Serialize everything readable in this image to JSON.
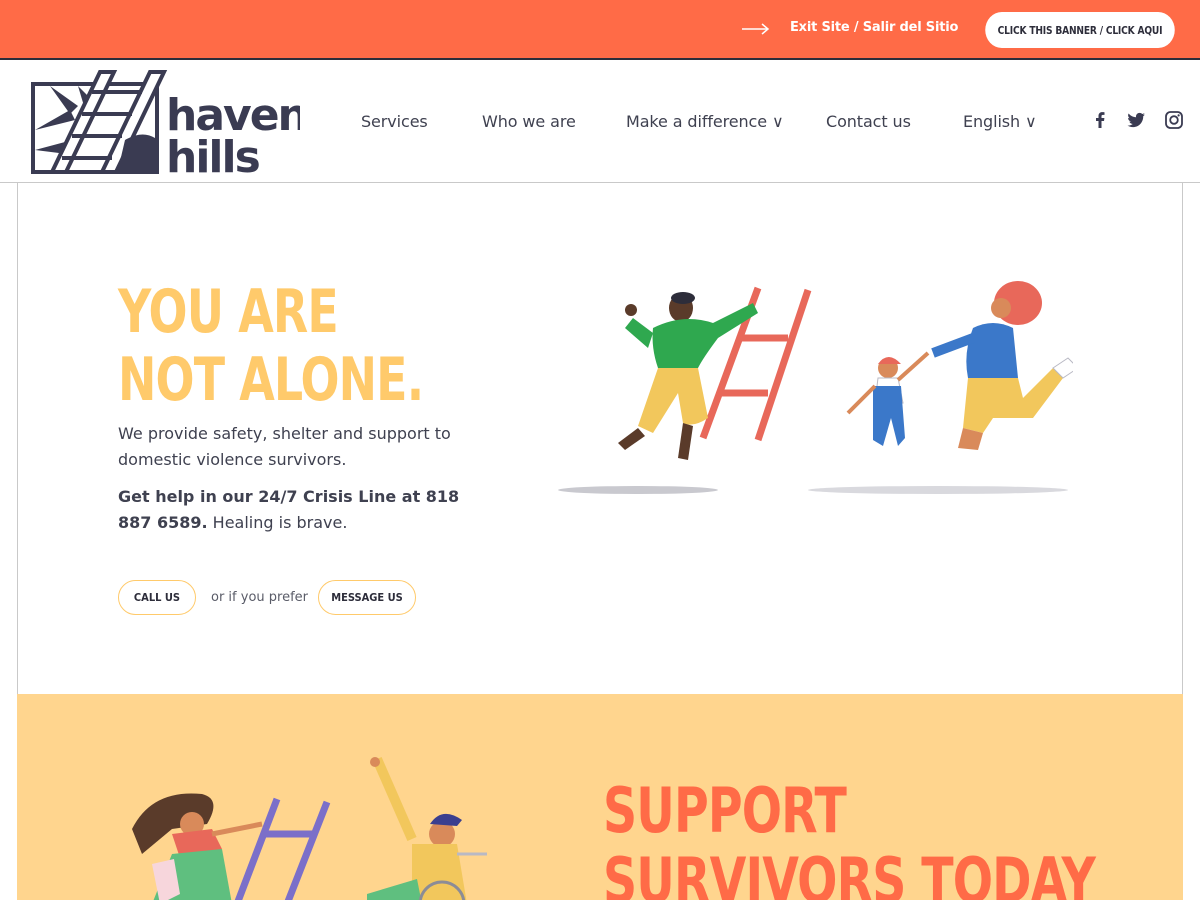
{
  "exit_banner": {
    "text": "Exit Site / Salir del Sitio",
    "button_label": "CLICK THIS BANNER / CLICK AQUI",
    "color": "#ff6b47"
  },
  "header": {
    "logo_text": "haven hills",
    "nav": [
      {
        "label": "Services"
      },
      {
        "label": "Who we are"
      },
      {
        "label": "Make a difference ∨"
      },
      {
        "label": "Contact us"
      },
      {
        "label": "English ∨"
      }
    ],
    "social_icons": [
      "facebook-icon",
      "twitter-icon",
      "instagram-icon"
    ]
  },
  "hero": {
    "title_line1": "YOU ARE",
    "title_line2": "NOT ALONE.",
    "paragraph1": "We provide safety, shelter and support to domestic violence survivors.",
    "paragraph2_bold": "Get help in our 24/7 Crisis Line at 818 887 6589.",
    "paragraph2_rest": " Healing is brave.",
    "call_button": "CALL US",
    "or_text": "or if you prefer",
    "message_button": "MESSAGE US",
    "accent_color": "#ffca6b"
  },
  "support": {
    "title_line1": "SUPPORT",
    "title_line2": "SURVIVORS TODAY",
    "background_color": "#ffd58e",
    "title_color": "#ff6b47"
  }
}
